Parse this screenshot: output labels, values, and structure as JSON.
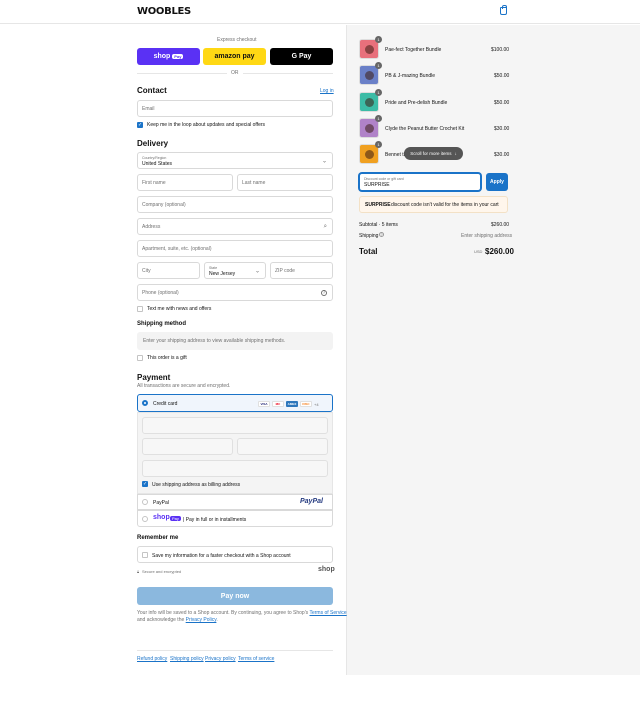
{
  "brand": {
    "logo": "WOOBLES"
  },
  "express": {
    "heading": "Express checkout",
    "shop_label": "shop",
    "shop_pay": "Pay",
    "amazon_label": "amazon pay",
    "gpay_label": "G Pay",
    "or": "OR"
  },
  "contact": {
    "heading": "Contact",
    "login": "Log in",
    "email_placeholder": "Email",
    "newsletter_label": "Keep me in the loop about updates and special offers"
  },
  "delivery": {
    "heading": "Delivery",
    "country_label": "Country/Region",
    "country_value": "United States",
    "first_name": "First name",
    "last_name": "Last name",
    "company": "Company (optional)",
    "address": "Address",
    "apartment": "Apartment, suite, etc. (optional)",
    "city": "City",
    "state_label": "State",
    "state_value": "New Jersey",
    "zip": "ZIP code",
    "phone": "Phone (optional)",
    "text_news": "Text me with news and offers"
  },
  "shipping_method": {
    "heading": "Shipping method",
    "placeholder": "Enter your shipping address to view available shipping methods.",
    "gift_label": "This order is a gift"
  },
  "payment": {
    "heading": "Payment",
    "subtext": "All transactions are secure and encrypted.",
    "credit_card": "Credit card",
    "card_brands": [
      "VISA",
      "MC",
      "AMEX",
      "DISC"
    ],
    "more_cards": "+4",
    "billing_same": "Use shipping address as billing address",
    "paypal": "PayPal",
    "paypal_logo": "PayPal",
    "shop_pay_logo": "shop",
    "shop_pay_pill": "Pay",
    "shop_pay_text": "| Pay in full or in installments"
  },
  "remember": {
    "heading": "Remember me",
    "save_label": "Save my information for a faster checkout with a Shop account",
    "secure": "Secure and encrypted",
    "shop_logo": "shop"
  },
  "pay_button": "Pay now",
  "legal": {
    "prefix": "Your info will be saved to a Shop account. By continuing, you agree to Shop's",
    "tos": "Terms of Service",
    "mid": "and acknowledge the",
    "privacy": "Privacy Policy",
    "suffix": "."
  },
  "footer_links": [
    "Refund policy",
    "Shipping policy",
    "Privacy policy",
    "Terms of service"
  ],
  "cart": {
    "items": [
      {
        "name": "Pae-fect Together Bundle",
        "price": "$100.00",
        "qty": "1",
        "color": "#e8707c"
      },
      {
        "name": "PB & J-mazing Bundle",
        "price": "$50.00",
        "qty": "1",
        "color": "#6a80c8"
      },
      {
        "name": "Pride and Pre-delish Bundle",
        "price": "$50.00",
        "qty": "1",
        "color": "#3cbca6"
      },
      {
        "name": "Clyde the Peanut Butter Crochet Kit",
        "price": "$30.00",
        "qty": "1",
        "color": "#b082c8"
      },
      {
        "name": "Bennet th",
        "price": "$30.00",
        "qty": "1",
        "color": "#f0a020"
      }
    ],
    "scroll_hint": "Scroll for more items",
    "discount_label": "Discount code or gift card",
    "discount_value": "SURPRISE",
    "apply": "Apply",
    "notice_code": "SURPRISE",
    "notice_text": "discount code isn't valid for the items in your cart",
    "subtotal_label": "Subtotal · 5 items",
    "subtotal_value": "$260.00",
    "shipping_label": "Shipping",
    "shipping_value": "Enter shipping address",
    "total_label": "Total",
    "currency": "USD",
    "total_value": "$260.00"
  }
}
